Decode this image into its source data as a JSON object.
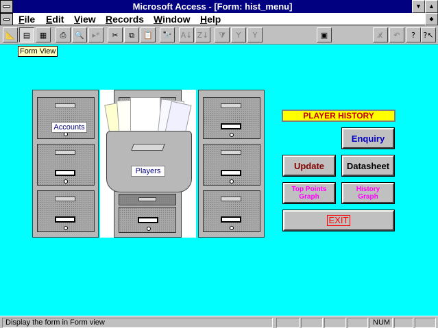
{
  "window": {
    "title": "Microsoft Access - [Form: hist_menu]"
  },
  "menu": [
    {
      "label": "File",
      "ul": "F",
      "rest": "ile"
    },
    {
      "label": "Edit",
      "ul": "E",
      "rest": "dit"
    },
    {
      "label": "View",
      "ul": "V",
      "rest": "iew"
    },
    {
      "label": "Records",
      "ul": "R",
      "rest": "ecords"
    },
    {
      "label": "Window",
      "ul": "W",
      "rest": "indow"
    },
    {
      "label": "Help",
      "ul": "H",
      "rest": "elp"
    }
  ],
  "tooltip": "Form View",
  "form": {
    "title": "PLAYER HISTORY",
    "cabinet_labels": {
      "accounts": "Accounts",
      "players": "Players"
    },
    "buttons": {
      "enquiry": "Enquiry",
      "update": "Update",
      "datasheet": "Datasheet",
      "top_points_graph": "Top Points Graph",
      "history_graph": "History Graph",
      "exit": "EXIT"
    }
  },
  "status": {
    "message": "Display the form in Form view",
    "num": "NUM"
  },
  "colors": {
    "title_bar": "#000080",
    "workarea": "#00ffff",
    "enquiry_text": "#0000c0",
    "update_text": "#800000",
    "graph_text": "#ff00ff",
    "exit_text": "#ff0000"
  }
}
